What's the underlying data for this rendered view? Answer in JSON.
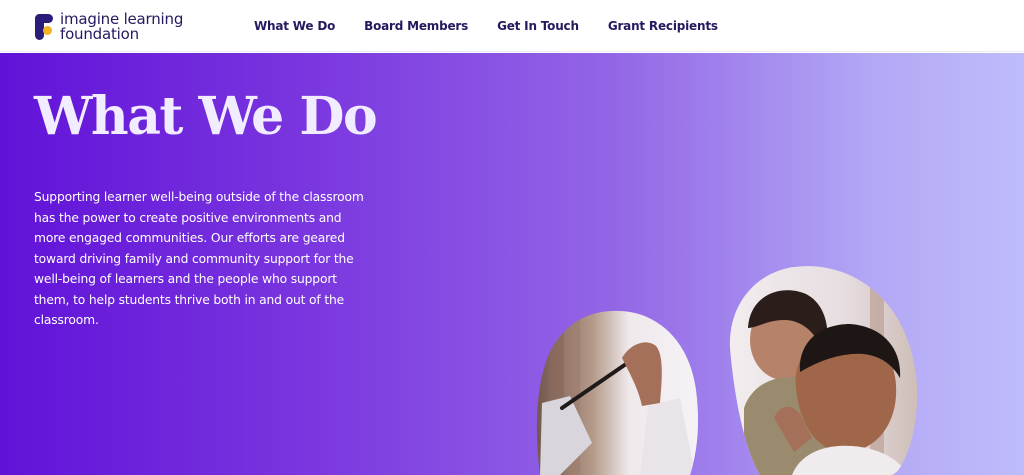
{
  "brand": {
    "name_line1": "imagine learning",
    "name_line2": "foundation",
    "colors": {
      "primary": "#25195f",
      "accent_yellow": "#f4b323",
      "hero_start": "#6112d8",
      "hero_end": "#bfbcfb"
    }
  },
  "nav": {
    "items": [
      {
        "label": "What We Do"
      },
      {
        "label": "Board Members"
      },
      {
        "label": "Get In Touch"
      },
      {
        "label": "Grant Recipients"
      }
    ]
  },
  "hero": {
    "title": "What We Do",
    "body": "Supporting learner well-being outside of the classroom has the power to create positive environments and more engaged communities. Our efforts are geared toward driving family and community support for the well-being of learners and the people who support them, to help students thrive both in and out of the classroom."
  }
}
